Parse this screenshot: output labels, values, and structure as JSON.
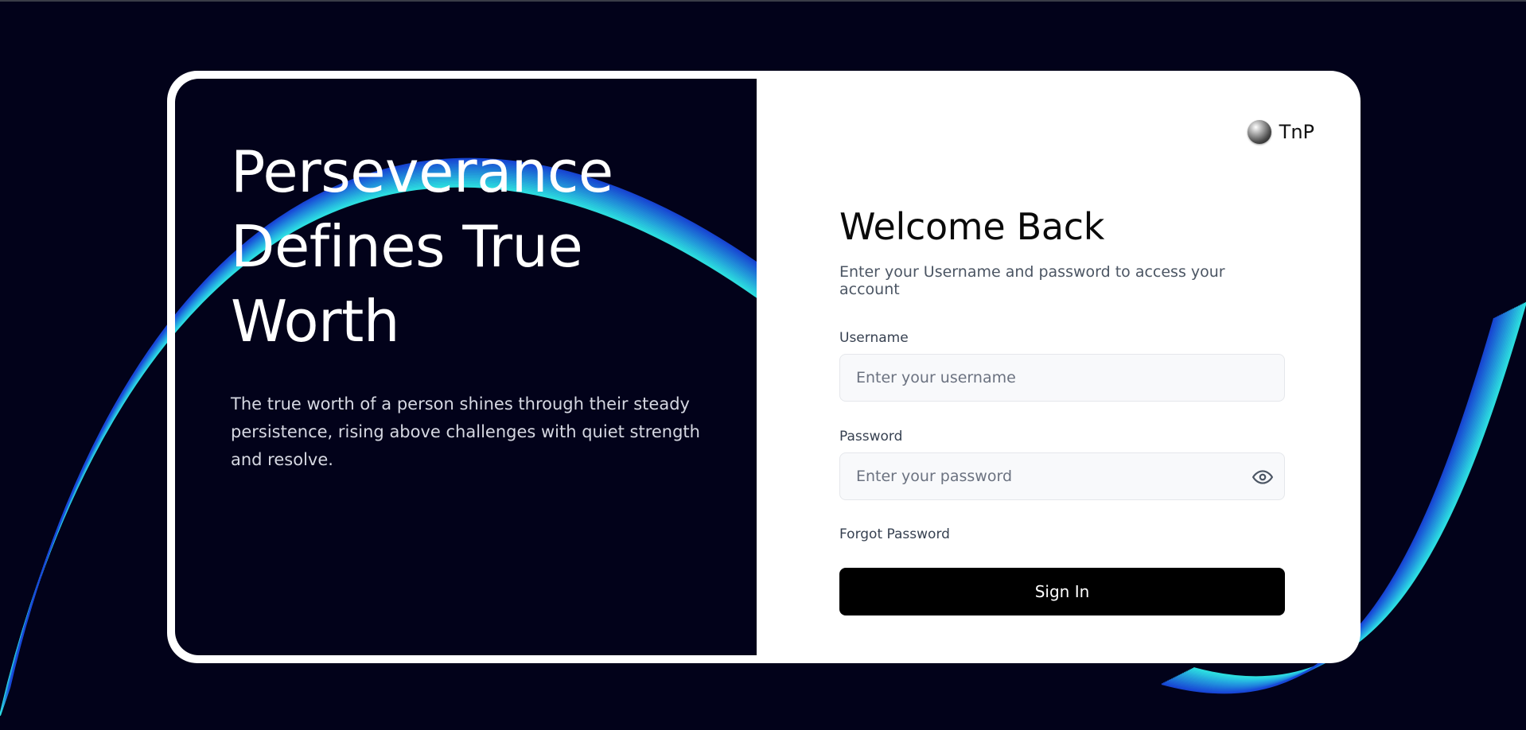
{
  "brand": {
    "name": "TnP"
  },
  "hero": {
    "headline_lines": [
      "Perseverance",
      "Defines True",
      "Worth"
    ],
    "tagline": "The true worth of a person shines through their steady persistence, rising above challenges with quiet strength and resolve."
  },
  "login": {
    "title": "Welcome Back",
    "subtitle": "Enter your Username and password to access your account",
    "username_label": "Username",
    "username_placeholder": "Enter your username",
    "username_value": "",
    "password_label": "Password",
    "password_placeholder": "Enter your password",
    "password_value": "",
    "forgot_label": "Forgot Password",
    "submit_label": "Sign In"
  },
  "icons": {
    "brand_logo": "sphere-logo-icon",
    "password_toggle": "eye-icon"
  },
  "colors": {
    "background": "#02021a",
    "card": "#ffffff",
    "button": "#000000",
    "wave_light": "#2ee6e6",
    "wave_dark": "#1848d8"
  }
}
